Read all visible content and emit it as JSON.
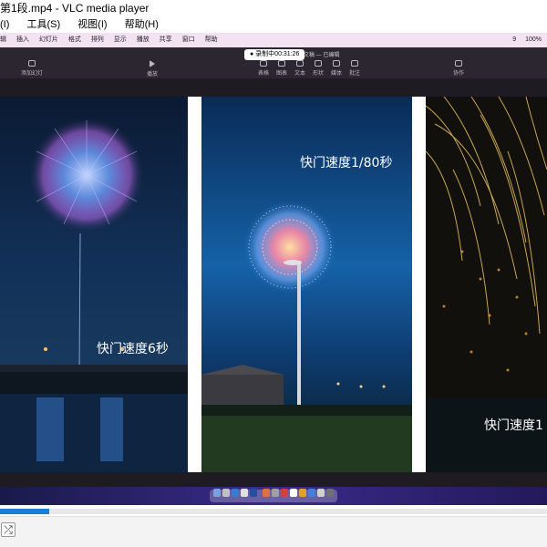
{
  "window": {
    "title": "第1段.mp4 - VLC media player"
  },
  "vlc_menu": [
    {
      "label": "(I)"
    },
    {
      "label": "工具(S)"
    },
    {
      "label": "视图(I)"
    },
    {
      "label": "帮助(H)"
    }
  ],
  "mac_menubar": {
    "items": [
      "插入",
      "幻灯片",
      "格式",
      "排列",
      "显示",
      "播放",
      "共享",
      "窗口",
      "帮助"
    ],
    "left_partial": "辑",
    "status_right": [
      "9",
      "100%"
    ]
  },
  "keynote": {
    "recording": "● 录制中00:31:26",
    "doc_title": "文稿 — 已编辑",
    "left_labels": [
      "添加幻灯片"
    ],
    "play_label": "播放",
    "tools": [
      "表格",
      "图表",
      "文本",
      "形状",
      "媒体",
      "批注"
    ],
    "right_tool": "协作"
  },
  "captions": {
    "p1": "快门速度6秒",
    "p2": "快门速度1/80秒",
    "p3": "快门速度1"
  },
  "playback": {
    "progress": 0.09
  },
  "colors": {
    "seek_fill": "#1a7fd6",
    "mac_menubar": "#f2e2f2"
  }
}
